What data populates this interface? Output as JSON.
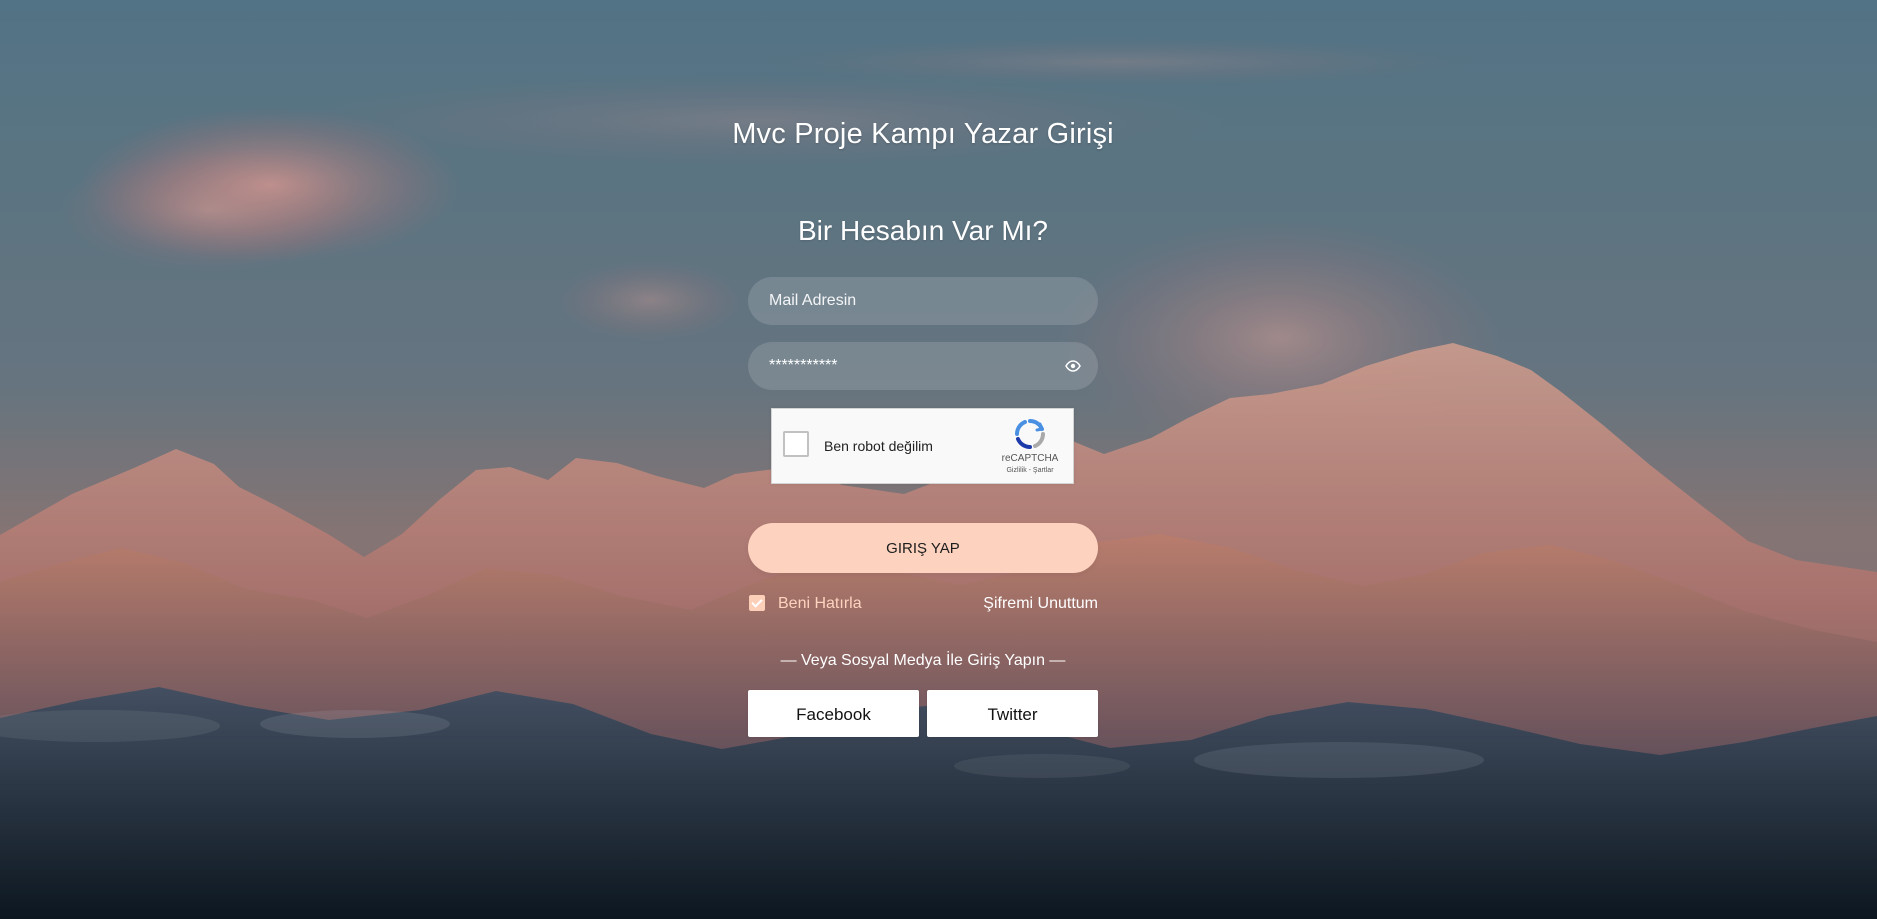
{
  "login": {
    "title": "Mvc Proje Kampı Yazar Girişi",
    "subtitle": "Bir Hesabın Var Mı?",
    "email_placeholder": "Mail Adresin",
    "password_mask": "***********",
    "captcha": {
      "label": "Ben robot değilim",
      "brand": "reCAPTCHA",
      "links": "Gizlilik - Şartlar"
    },
    "login_button": "GIRIŞ YAP",
    "remember_label": "Beni Hatırla",
    "forgot_label": "Şifremi Unuttum",
    "social_caption": "— Veya Sosyal Medya İle Giriş Yapın —",
    "facebook_label": "Facebook",
    "twitter_label": "Twitter"
  },
  "icons": {
    "password_visibility": "eye-icon",
    "captcha_logo": "recaptcha-icon",
    "remember_state": "checkbox-checked"
  },
  "colors": {
    "button_accent": "#fdd3bf",
    "text_primary": "#ffffff"
  }
}
